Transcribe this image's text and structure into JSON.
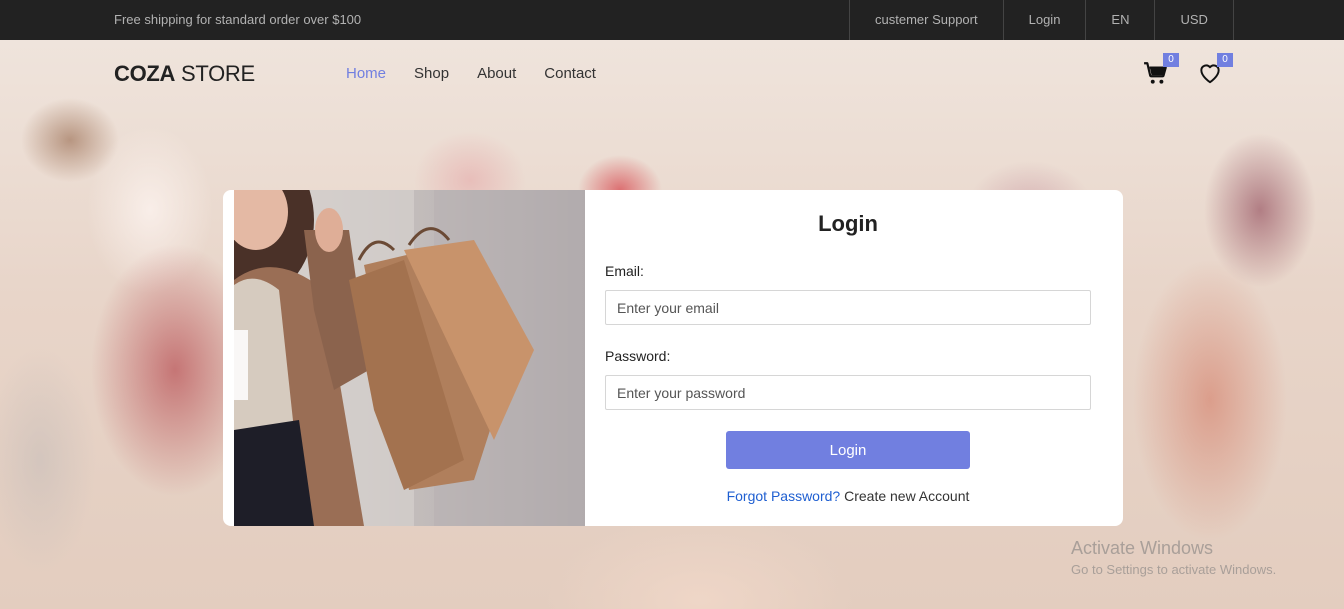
{
  "topbar": {
    "promo": "Free shipping for standard order over $100",
    "links": [
      "custemer Support",
      "Login",
      "EN",
      "USD"
    ]
  },
  "brand": {
    "bold": "COZA",
    "rest": " STORE"
  },
  "nav": {
    "items": [
      "Home",
      "Shop",
      "About",
      "Contact"
    ],
    "active": "Home"
  },
  "header_icons": {
    "cart": {
      "icon": "cart-icon",
      "count": "0"
    },
    "wishlist": {
      "icon": "heart-icon",
      "count": "0"
    }
  },
  "login": {
    "title": "Login",
    "email_label": "Email:",
    "email_placeholder": "Enter your email",
    "password_label": "Password:",
    "password_placeholder": "Enter your password",
    "submit_label": "Login",
    "forgot_link": "Forgot Password?",
    "create_link": " Create new Account"
  },
  "watermark": {
    "line1": "Activate Windows",
    "line2": "Go to Settings to activate Windows."
  },
  "colors": {
    "accent": "#717fe0",
    "topbar": "#222222",
    "link": "#1f5fd1"
  }
}
